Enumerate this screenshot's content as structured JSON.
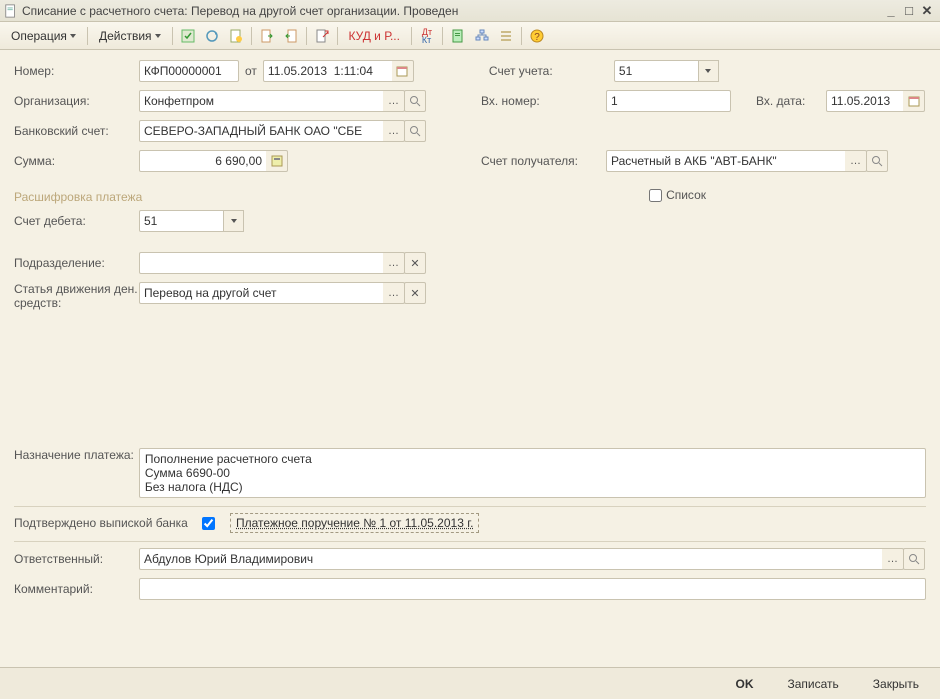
{
  "title": "Списание с расчетного счета: Перевод на другой счет организации. Проведен",
  "toolbar": {
    "operation": "Операция",
    "actions": "Действия",
    "kudr": "КУД и Р..."
  },
  "labels": {
    "number": "Номер:",
    "from": "от",
    "org": "Организация:",
    "bank_account": "Банковский счет:",
    "sum": "Сумма:",
    "account_of": "Счет учета:",
    "in_number": "Вх. номер:",
    "in_date": "Вх. дата:",
    "recipient_account": "Счет получателя:",
    "breakdown": "Расшифровка платежа",
    "list": "Список",
    "debit_account": "Счет дебета:",
    "department": "Подразделение:",
    "movement_article": "Статья движения ден. средств:",
    "purpose": "Назначение платежа:",
    "confirmed": "Подтверждено выпиской банка",
    "payment_order": "Платежное поручение № 1 от 11.05.2013 г.",
    "responsible": "Ответственный:",
    "comment": "Комментарий:"
  },
  "values": {
    "number": "КФП00000001",
    "date": "11.05.2013  1:11:04",
    "org": "Конфетпром",
    "bank_account": "СЕВЕРО-ЗАПАДНЫЙ БАНК ОАО \"СБЕ",
    "sum": "6 690,00",
    "account_of": "51",
    "in_number": "1",
    "in_date": "11.05.2013",
    "recipient_account": "Расчетный в АКБ \"АВТ-БАНК\"",
    "debit_account": "51",
    "department": "",
    "movement_article": "Перевод на другой счет",
    "purpose": "Пополнение расчетного счета\nСумма 6690-00\nБез налога (НДС)",
    "responsible": "Абдулов Юрий Владимирович",
    "comment": ""
  },
  "footer": {
    "ok": "OK",
    "write": "Записать",
    "close": "Закрыть"
  }
}
